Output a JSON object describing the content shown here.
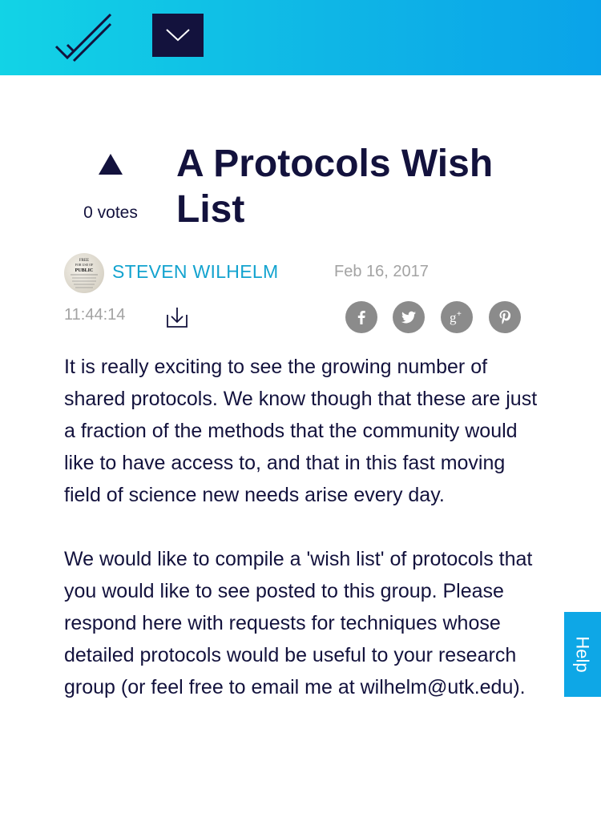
{
  "header": {
    "logo_icon": "double-check-icon",
    "menu_icon": "chevron-down-icon"
  },
  "post": {
    "upvote_icon": "triangle-up-icon",
    "votes": "0 votes",
    "title": "A Protocols Wish List",
    "author": "STEVEN WILHELM",
    "date": "Feb 16, 2017",
    "time": "11:44:14",
    "download_icon": "download-icon",
    "avatar_text": [
      "FREE",
      "FOR USE OF",
      "PUBLIC"
    ],
    "social": [
      "facebook-icon",
      "twitter-icon",
      "google-plus-icon",
      "pinterest-icon"
    ],
    "paragraphs": [
      "It is really exciting to see the growing number of shared protocols.  We know though that these are just a fraction of the methods that the community would like to have access to, and that in this fast moving field of science new needs arise every day.",
      "We would like to compile a 'wish list' of protocols that you would like to see posted to this group. Please respond here with requests for techniques whose detailed protocols would be useful to your research group (or feel free to email me at wilhelm@utk.edu)."
    ]
  },
  "help": {
    "label": "Help"
  },
  "colors": {
    "header_gradient_start": "#12d3e6",
    "header_gradient_end": "#0aa3e9",
    "navy": "#13123d",
    "author_link": "#13a3cf",
    "help_bg": "#0ea7e6",
    "meta_gray": "#a3a3a3",
    "social_gray": "#8b8b8b"
  }
}
